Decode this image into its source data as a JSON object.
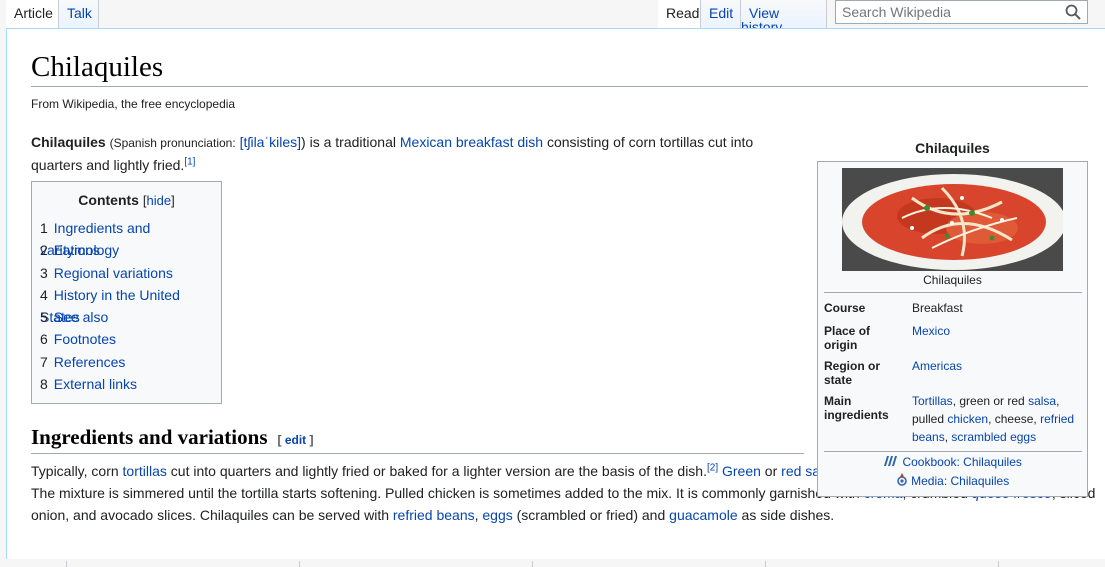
{
  "tabs": {
    "article": "Article",
    "talk": "Talk",
    "read": "Read",
    "edit": "Edit",
    "history": "View history"
  },
  "search": {
    "placeholder": "Search Wikipedia"
  },
  "page": {
    "title": "Chilaquiles",
    "tagline": "From Wikipedia, the free encyclopedia"
  },
  "intro": {
    "term": "Chilaquiles",
    "pron_label": "(Spanish pronunciation:",
    "ipa": "[tʃilaˈkiles]",
    "pron_close": ")",
    "t1": " is a traditional ",
    "link1": "Mexican breakfast dish",
    "t2": " consisting of corn tortillas cut into quarters and lightly fried.",
    "ref1": "[1]"
  },
  "toc": {
    "title": "Contents",
    "hide": "hide",
    "items": [
      {
        "num": "1",
        "label": "Ingredients and variations"
      },
      {
        "num": "2",
        "label": "Etymology"
      },
      {
        "num": "3",
        "label": "Regional variations"
      },
      {
        "num": "4",
        "label": "History in the United States"
      },
      {
        "num": "5",
        "label": "See also"
      },
      {
        "num": "6",
        "label": "Footnotes"
      },
      {
        "num": "7",
        "label": "References"
      },
      {
        "num": "8",
        "label": "External links"
      }
    ]
  },
  "section1": {
    "heading": "Ingredients and variations",
    "edit": "edit",
    "p": {
      "a": "Typically, corn ",
      "tortillas": "tortillas",
      "b": " cut into quarters and lightly fried or baked for a lighter version are the basis of the dish.",
      "ref2": "[2]",
      "green": "Green",
      "or": " or ",
      "red_salsa": "red salsa",
      "c": " is poured over the crisp tortilla triangles. The mixture is simmered until the tortilla starts softening. Pulled chicken is sometimes added to the mix. It is commonly garnished with ",
      "crema": "crema",
      "d": ", crumbled ",
      "queso": "queso fresco",
      "e": ", sliced onion, and avocado slices. Chilaquiles can be served with ",
      "refried": "refried beans",
      "f": ", ",
      "eggs": "eggs",
      "g": " (scrambled or fried) and ",
      "guacamole": "guacamole",
      "h": " as side dishes."
    }
  },
  "infobox": {
    "caption": "Chilaquiles",
    "image_caption": "Chilaquiles",
    "rows": {
      "course": {
        "label": "Course",
        "value": "Breakfast"
      },
      "origin": {
        "label": "Place of origin",
        "value": "Mexico"
      },
      "region": {
        "label": "Region or state",
        "value": "Americas"
      },
      "ingredients": {
        "label": "Main ingredients",
        "tortillas": "Tortillas",
        "t1": ", green or red ",
        "salsa": "salsa",
        "t2": ", pulled ",
        "chicken": "chicken",
        "t3": ", cheese, ",
        "refried": "refried beans",
        "t4": ", ",
        "eggs": "scrambled eggs"
      }
    },
    "cookbook": "Cookbook: Chilaquiles",
    "media": "Media: Chilaquiles"
  }
}
